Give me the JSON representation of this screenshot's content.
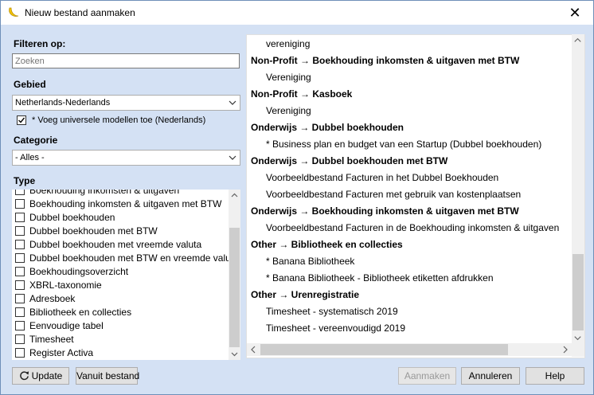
{
  "window": {
    "title": "Nieuw bestand aanmaken",
    "close_glyph": "✕"
  },
  "filter": {
    "label": "Filteren op:",
    "placeholder": "Zoeken"
  },
  "gebied": {
    "label": "Gebied",
    "selected": "Netherlands-Nederlands",
    "checkbox_label": "* Voeg universele modellen toe (Nederlands)",
    "checkbox_checked": true
  },
  "categorie": {
    "label": "Categorie",
    "selected": "- Alles -"
  },
  "type": {
    "label": "Type",
    "items": [
      "Boekhouding inkomsten & uitgaven",
      "Boekhouding inkomsten & uitgaven met BTW",
      "Dubbel boekhouden",
      "Dubbel boekhouden met BTW",
      "Dubbel boekhouden met vreemde valuta",
      "Dubbel boekhouden met BTW en vreemde valuta",
      "Boekhoudingsoverzicht",
      "XBRL-taxonomie",
      "Adresboek",
      "Bibliotheek en collecties",
      "Eenvoudige tabel",
      "Timesheet",
      "Register Activa"
    ]
  },
  "templates": [
    {
      "kind": "entry",
      "text": "vereniging"
    },
    {
      "kind": "group",
      "text": "Non-Profit → Boekhouding inkomsten & uitgaven met BTW"
    },
    {
      "kind": "entry",
      "text": "Vereniging"
    },
    {
      "kind": "group",
      "text": "Non-Profit → Kasboek"
    },
    {
      "kind": "entry",
      "text": "Vereniging"
    },
    {
      "kind": "group",
      "text": "Onderwijs → Dubbel boekhouden"
    },
    {
      "kind": "entry",
      "text": "* Business plan en budget van een Startup (Dubbel boekhouden)"
    },
    {
      "kind": "group",
      "text": "Onderwijs → Dubbel boekhouden met BTW"
    },
    {
      "kind": "entry",
      "text": "Voorbeeldbestand Facturen in het Dubbel Boekhouden"
    },
    {
      "kind": "entry",
      "text": "Voorbeeldbestand Facturen met gebruik van kostenplaatsen"
    },
    {
      "kind": "group",
      "text": "Onderwijs → Boekhouding inkomsten & uitgaven met BTW"
    },
    {
      "kind": "entry",
      "text": "Voorbeeldbestand Facturen in de Boekhouding inkomsten & uitgaven"
    },
    {
      "kind": "group",
      "text": "Other → Bibliotheek en collecties"
    },
    {
      "kind": "entry",
      "text": "* Banana Bibliotheek"
    },
    {
      "kind": "entry",
      "text": "* Banana Bibliotheek - Bibliotheek etiketten afdrukken"
    },
    {
      "kind": "group",
      "text": "Other → Urenregistratie"
    },
    {
      "kind": "entry",
      "text": "Timesheet - systematisch 2019"
    },
    {
      "kind": "entry",
      "text": "Timesheet - vereenvoudigd 2019"
    }
  ],
  "buttons": {
    "update": "Update",
    "vanuit_bestand": "Vanuit bestand",
    "aanmaken": "Aanmaken",
    "annuleren": "Annuleren",
    "help": "Help"
  },
  "colors": {
    "accent": "#d4e1f4",
    "check": "#000000"
  }
}
